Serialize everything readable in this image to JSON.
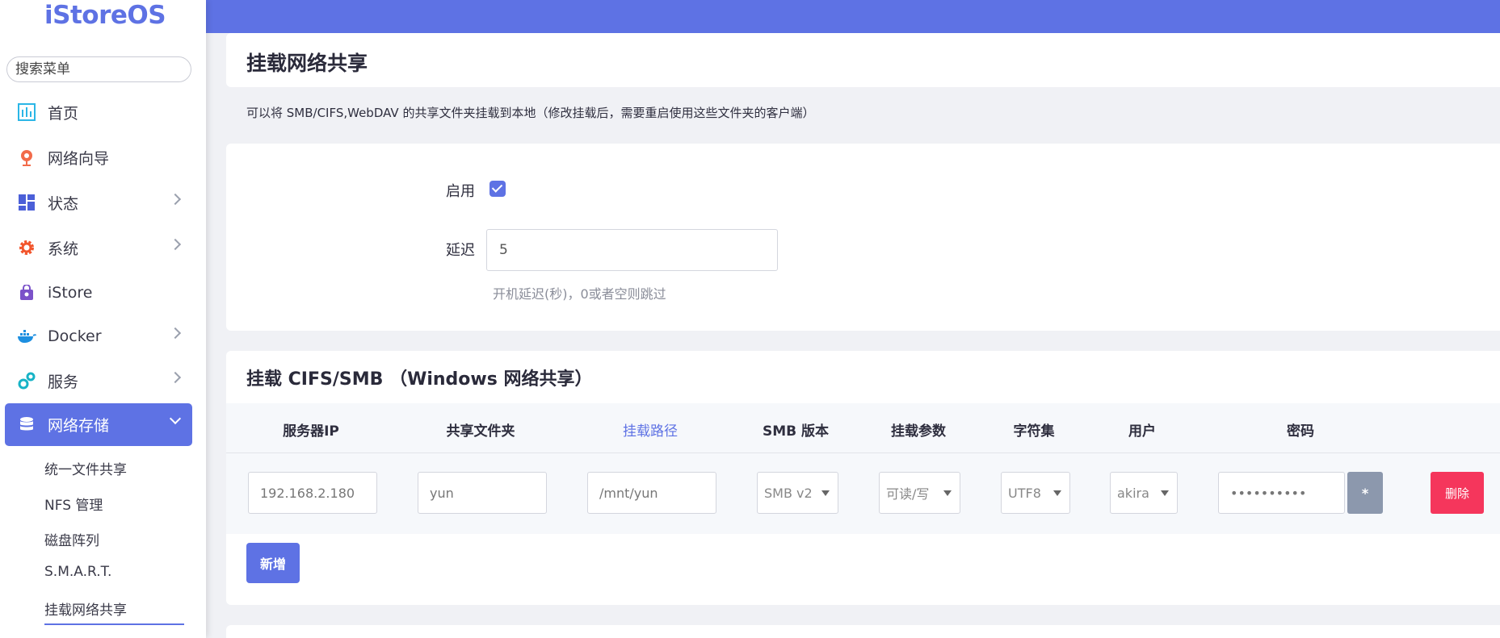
{
  "sidebar": {
    "logo": "iStoreOS",
    "search_placeholder": "搜索菜单",
    "items": [
      {
        "label": "首页",
        "icon": "dashboard-chart-icon"
      },
      {
        "label": "网络向导",
        "icon": "globe-wizard-icon"
      },
      {
        "label": "状态",
        "icon": "grid-status-icon"
      },
      {
        "label": "系统",
        "icon": "gear-icon"
      },
      {
        "label": "iStore",
        "icon": "store-bag-icon"
      },
      {
        "label": "Docker",
        "icon": "docker-whale-icon"
      },
      {
        "label": "服务",
        "icon": "services-gears-icon"
      },
      {
        "label": "网络存储",
        "icon": "database-icon"
      }
    ],
    "sub_items": [
      {
        "label": "统一文件共享"
      },
      {
        "label": "NFS 管理"
      },
      {
        "label": "磁盘阵列"
      },
      {
        "label": "S.M.A.R.T."
      },
      {
        "label": "挂载网络共享"
      }
    ]
  },
  "page": {
    "title": "挂载网络共享",
    "description": "可以将 SMB/CIFS,WebDAV 的共享文件夹挂载到本地（修改挂载后，需要重启使用这些文件夹的客户端）"
  },
  "settings": {
    "enable_label": "启用",
    "delay_label": "延迟",
    "delay_value": "5",
    "delay_hint": "开机延迟(秒)，0或者空则跳过"
  },
  "smb": {
    "section_title": "挂载 CIFS/SMB （Windows 网络共享）",
    "columns": [
      "服务器IP",
      "共享文件夹",
      "挂载路径",
      "SMB 版本",
      "挂载参数",
      "字符集",
      "用户",
      "密码"
    ],
    "row": {
      "server_ip": "192.168.2.180",
      "share_folder": "yun",
      "mount_path": "/mnt/yun",
      "smb_version": "SMB v2",
      "mount_params": "可读/写",
      "charset": "UTF8",
      "user": "akira",
      "password": "••••••••••",
      "reveal_label": "*",
      "delete_label": "删除"
    },
    "add_label": "新增"
  }
}
